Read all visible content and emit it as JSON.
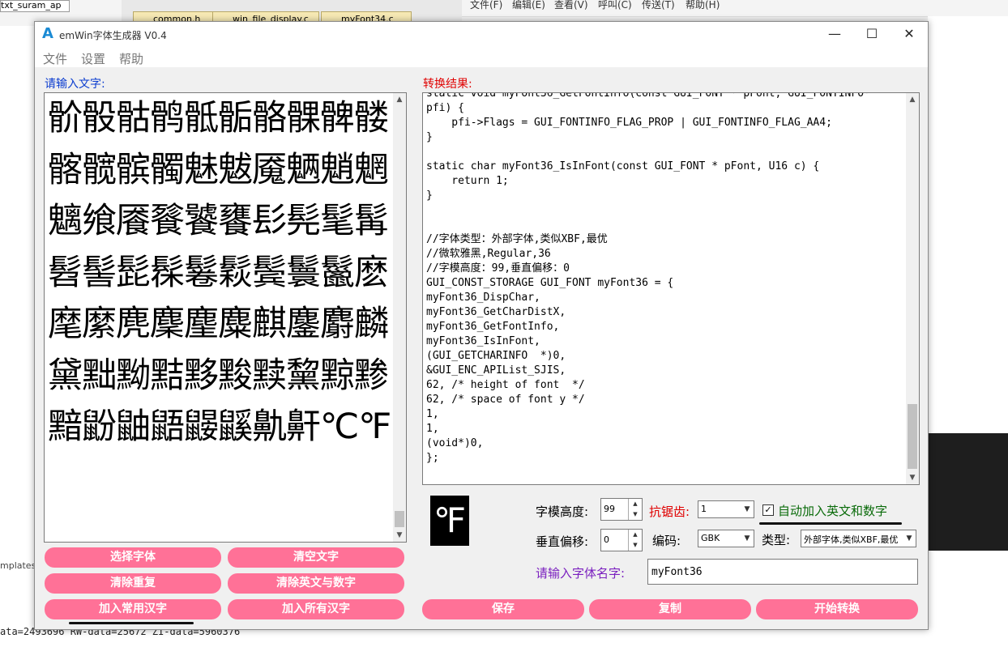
{
  "background": {
    "combo_text": "txt_suram_ap",
    "tabs": [
      "common.h",
      "win_file_display.c",
      "myFont34.c"
    ],
    "menus": [
      "文件(F)",
      "编辑(E)",
      "查看(V)",
      "呼叫(C)",
      "传送(T)",
      "帮助(H)"
    ],
    "templates_label": "mplates",
    "build_output": "ata=2493696 RW-data=25672 ZI-data=5960376"
  },
  "window": {
    "title": "emWin字体生成器 V0.4",
    "icon_glyph": "A",
    "minimize_glyph": "—",
    "maximize_glyph": "☐",
    "close_glyph": "✕"
  },
  "menu": [
    "文件",
    "设置",
    "帮助"
  ],
  "input_label": "请输入文字:",
  "output_label": "转换结果:",
  "input_text": "骱骰骷鹘骶骺骼髁髀髅髂髋髌髑魅魃魇魉魈魍魑飨餍餮饕饔髟髡髦髯髫髻髭髹鬈鬏鬓鬟鬣麽麾縻麂麇麈麋麒鏖麝麟黛黜黝黠黟黢黩黧黥黪黯鼢鼬鼯鼹鼷鼽鼾℃℉",
  "output_code": "static void myFont36_GetFontInfo(const GUI_FONT * pFont, GUI_FONTINFO*\npfi) {\n    pfi->Flags = GUI_FONTINFO_FLAG_PROP | GUI_FONTINFO_FLAG_AA4;\n}\n\nstatic char myFont36_IsInFont(const GUI_FONT * pFont, U16 c) {\n    return 1;\n}\n\n\n//字体类型：外部字体,类似XBF,最优\n//微软雅黑,Regular,36\n//字模高度：99,垂直偏移：0\nGUI_CONST_STORAGE GUI_FONT myFont36 = {\nmyFont36_DispChar,\nmyFont36_GetCharDistX,\nmyFont36_GetFontInfo,\nmyFont36_IsInFont,\n(GUI_GETCHARINFO  *)0,\n&GUI_ENC_APIList_SJIS,\n62, /* height of font  */\n62, /* space of font y */\n1,\n1,\n(void*)0,\n};",
  "buttons_left": [
    [
      "选择字体",
      "清空文字"
    ],
    [
      "清除重复",
      "清除英文与数字"
    ],
    [
      "加入常用汉字",
      "加入所有汉字"
    ]
  ],
  "preview_glyph": "℉",
  "glyph_height_label": "字模高度:",
  "glyph_height_value": "99",
  "antialias_label": "抗锯齿:",
  "antialias_value": "1",
  "auto_add_label": "自动加入英文和数字",
  "auto_add_checked": true,
  "vertical_offset_label": "垂直偏移:",
  "vertical_offset_value": "0",
  "encoding_label": "编码:",
  "encoding_value": "GBK",
  "type_label": "类型:",
  "type_value": "外部字体,类似XBF,最优",
  "fontname_label": "请输入字体名字:",
  "fontname_value": "myFont36",
  "buttons_bottom": [
    "保存",
    "复制",
    "开始转换"
  ],
  "colors": {
    "button_pink": "#ff7197",
    "label_blue": "#0a3ccf",
    "label_red": "#e00000",
    "label_purple": "#7a1fbf",
    "label_green": "#0a6b0a"
  }
}
